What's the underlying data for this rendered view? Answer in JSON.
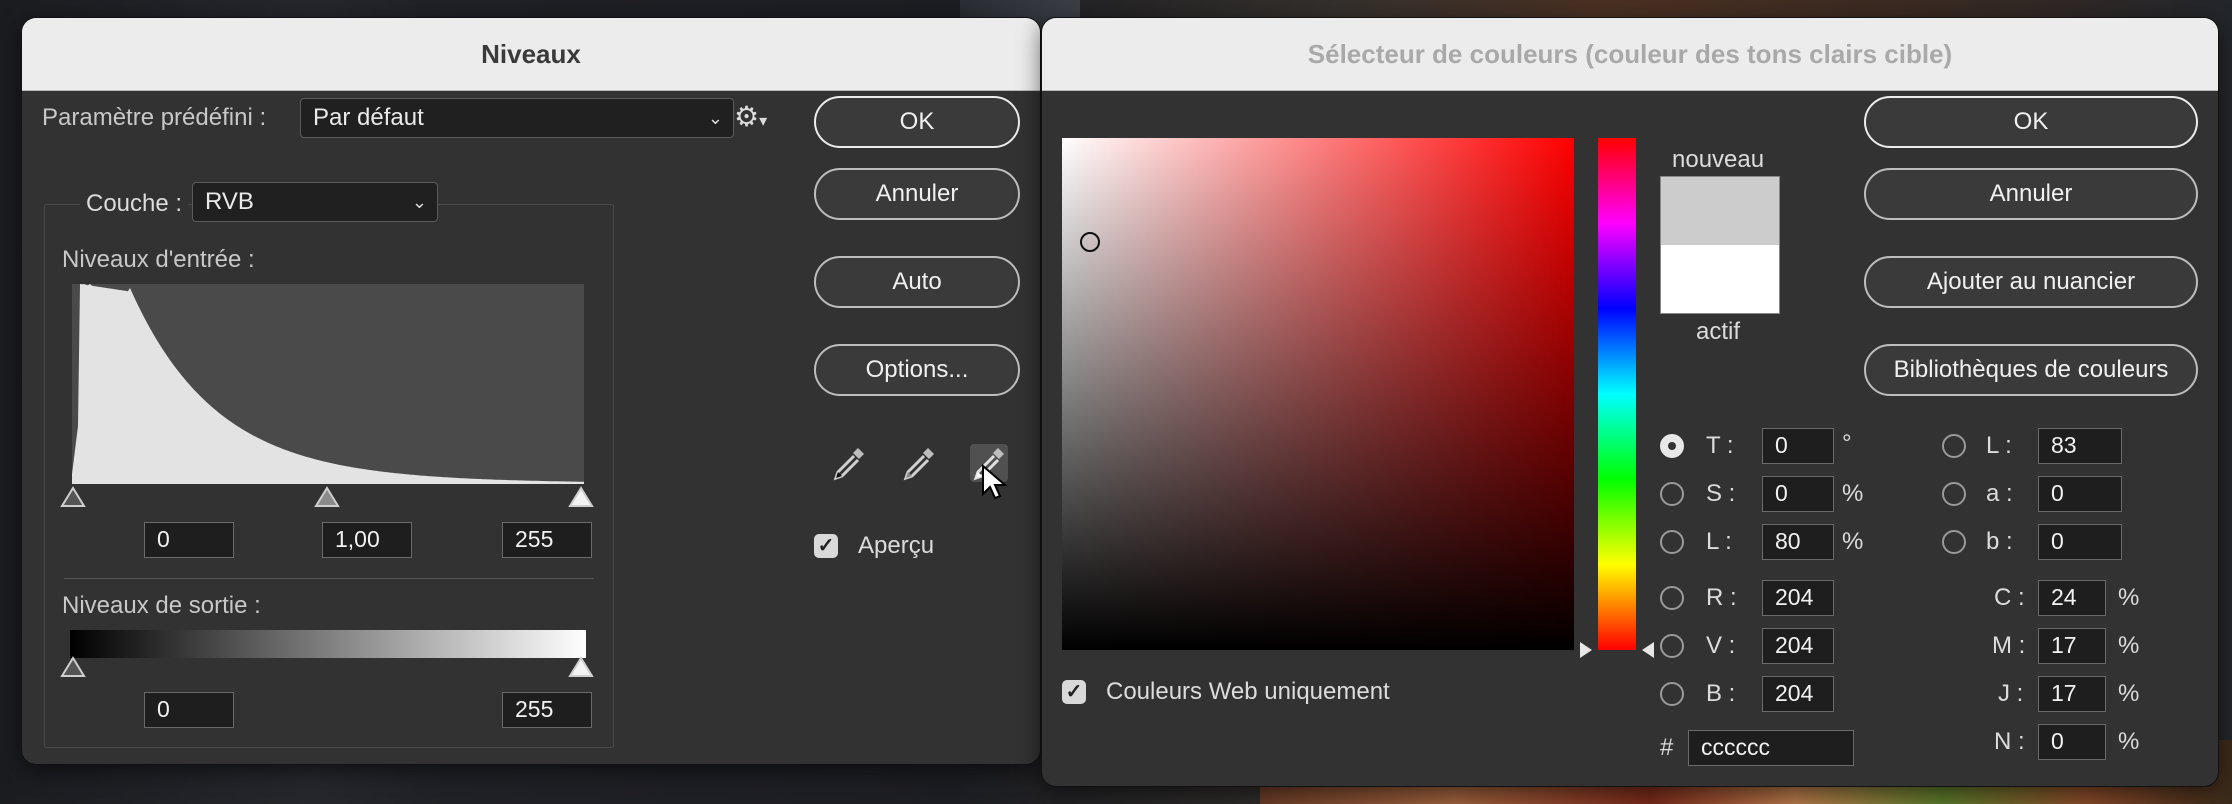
{
  "levels": {
    "title": "Niveaux",
    "preset_label": "Paramètre prédéfini :",
    "preset_value": "Par défaut",
    "channel_label": "Couche :",
    "channel_value": "RVB",
    "input_levels_label": "Niveaux d'entrée :",
    "input_black": "0",
    "input_gamma": "1,00",
    "input_white": "255",
    "output_levels_label": "Niveaux de sortie :",
    "output_black": "0",
    "output_white": "255",
    "buttons": {
      "ok": "OK",
      "cancel": "Annuler",
      "auto": "Auto",
      "options": "Options..."
    },
    "preview_label": "Aperçu",
    "preview_checked": true,
    "check_glyph": "✓",
    "gear_glyph": "⚙",
    "gear_caret": "▾",
    "chevron_glyph": "⌄"
  },
  "color_picker": {
    "title": "Sélecteur de couleurs (couleur des tons clairs cible)",
    "new_label": "nouveau",
    "current_label": "actif",
    "new_color": "#cccccc",
    "current_color": "#ffffff",
    "hue_color": "#ff0000",
    "buttons": {
      "ok": "OK",
      "cancel": "Annuler",
      "add_swatch": "Ajouter au nuancier",
      "libraries": "Bibliothèques de couleurs"
    },
    "web_only_label": "Couleurs Web uniquement",
    "web_only_checked": true,
    "hsb": [
      {
        "label": "T :",
        "value": "0",
        "unit": "°",
        "selected": true
      },
      {
        "label": "S :",
        "value": "0",
        "unit": "%",
        "selected": false
      },
      {
        "label": "L :",
        "value": "80",
        "unit": "%",
        "selected": false
      }
    ],
    "rgb": [
      {
        "label": "R :",
        "value": "204",
        "selected": false
      },
      {
        "label": "V :",
        "value": "204",
        "selected": false
      },
      {
        "label": "B :",
        "value": "204",
        "selected": false
      }
    ],
    "lab": [
      {
        "label": "L :",
        "value": "83",
        "selected": false
      },
      {
        "label": "a :",
        "value": "0",
        "selected": false
      },
      {
        "label": "b :",
        "value": "0",
        "selected": false
      }
    ],
    "cmyk": [
      {
        "label": "C :",
        "value": "24",
        "unit": "%"
      },
      {
        "label": "M :",
        "value": "17",
        "unit": "%"
      },
      {
        "label": "J :",
        "value": "17",
        "unit": "%"
      },
      {
        "label": "N :",
        "value": "0",
        "unit": "%"
      }
    ],
    "hex_label": "#",
    "hex_value": "cccccc"
  }
}
